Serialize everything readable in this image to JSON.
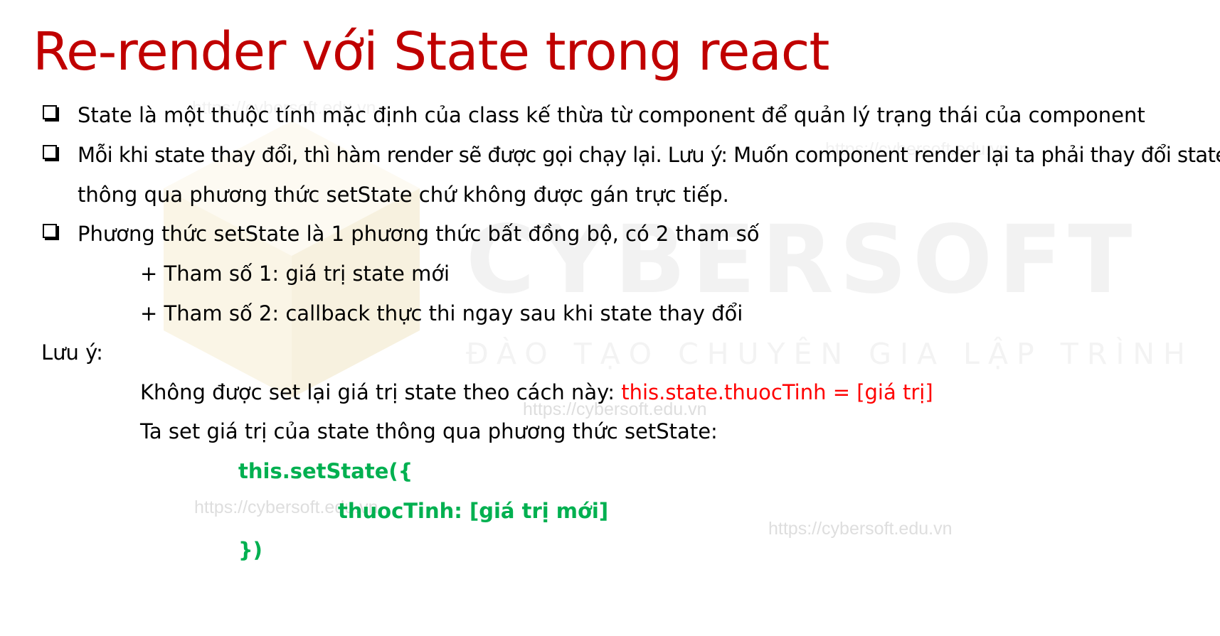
{
  "title": "Re-render với State trong react",
  "bullets": [
    {
      "lines": [
        "State là một thuộc tính mặc định của class kế thừa từ component để quản lý trạng thái của component"
      ]
    },
    {
      "lines": [
        "Mỗi khi state thay đổi, thì hàm render sẽ được gọi chạy lại. Lưu ý: Muốn component render lại ta phải thay đổi state",
        "thông qua phương thức setState chứ không được gán trực tiếp."
      ]
    },
    {
      "lines": [
        "Phương thức setState là 1 phương thức bất đồng bộ, có 2 tham số"
      ]
    }
  ],
  "params": [
    "+ Tham số 1: giá trị state mới",
    "+ Tham số 2: callback thực thi ngay sau khi state thay đổi"
  ],
  "note": {
    "label": "Lưu ý:",
    "line1_text": "Không được set lại giá trị state theo cách này: ",
    "line1_code": "this.state.thuocTinh = [giá trị]",
    "line2_text": "Ta set giá trị của state thông qua phương thức setState:"
  },
  "code": [
    "this.setState({",
    "thuocTinh: [giá trị mới]",
    "})"
  ],
  "watermark": {
    "brand": "CYBERSOFT",
    "tagline": "ĐÀO TẠO CHUYÊN GIA LẬP TRÌNH",
    "url": "https://cybersoft.edu.vn"
  },
  "colors": {
    "title": "#c00000",
    "inline_code": "#ff0000",
    "code_block": "#00b050"
  }
}
